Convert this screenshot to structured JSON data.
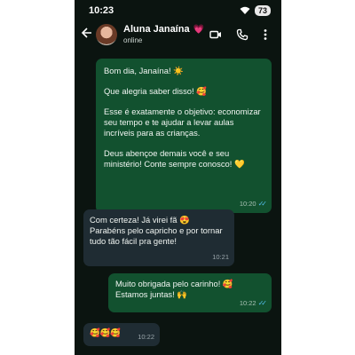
{
  "status_bar": {
    "time": "10:23",
    "battery": "73"
  },
  "header": {
    "contact_name": "Aluna Janaína",
    "name_emoji": "💗",
    "presence": "online"
  },
  "messages": [
    {
      "direction": "outgoing",
      "lines": [
        "Bom dia, Janaína! ☀️",
        "Que alegria saber disso! 🥰",
        "Esse é exatamente o objetivo: economizar seu tempo e te ajudar a levar aulas incríveis para as crianças.",
        "Deus abençoe demais você e seu ministério! Conte sempre conosco! 💛"
      ],
      "time": "10:20",
      "read": true
    },
    {
      "direction": "incoming",
      "lines": [
        "Com certeza! Já virei fã 😍",
        "Parabéns pelo capricho e por tornar tudo tão fácil pra gente!"
      ],
      "time": "10:21"
    },
    {
      "direction": "outgoing",
      "lines": [
        "Muito obrigada pelo carinho! 🥰",
        "Estamos juntas! 🙌"
      ],
      "time": "10:22",
      "read": true
    },
    {
      "direction": "incoming",
      "lines": [
        "🥰🥰🥰"
      ],
      "time": "10:22"
    }
  ],
  "icons": [
    "back-arrow-icon",
    "video-call-icon",
    "phone-icon",
    "more-options-icon",
    "wifi-icon",
    "read-receipt-icon"
  ],
  "colors": {
    "chat_background": "#0b1410",
    "outgoing_bubble": "#12512f",
    "incoming_bubble": "#1f2c33",
    "read_tick": "#53bdeb"
  }
}
